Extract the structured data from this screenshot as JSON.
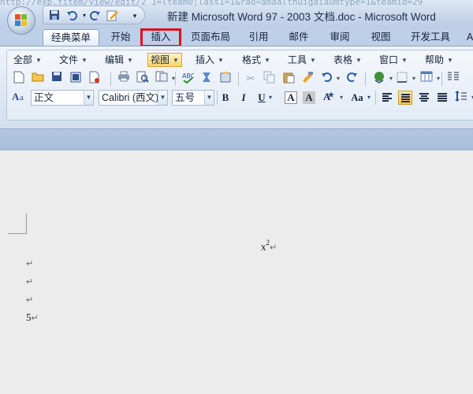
{
  "title_bar": {
    "url_ghost": "http://exp.fitem/view/edit/2 1=lteam0;lass1=1&rad=amaalthuigaiaumtype=1&teamid=29",
    "window_title": "新建 Microsoft Word 97 - 2003 文档.doc - Microsoft Word",
    "quick_access": [
      "save-icon",
      "undo-icon",
      "redo-icon",
      "customize-icon"
    ]
  },
  "tabs": [
    {
      "label": "经典菜单",
      "state": "active"
    },
    {
      "label": "开始"
    },
    {
      "label": "插入",
      "state": "highlighted"
    },
    {
      "label": "页面布局"
    },
    {
      "label": "引用"
    },
    {
      "label": "邮件"
    },
    {
      "label": "审阅"
    },
    {
      "label": "视图"
    },
    {
      "label": "开发工具"
    },
    {
      "label": "A"
    }
  ],
  "menu": [
    {
      "label": "全部"
    },
    {
      "label": "文件"
    },
    {
      "label": "编辑"
    },
    {
      "label": "视图",
      "state": "selected"
    },
    {
      "label": "插入"
    },
    {
      "label": "格式"
    },
    {
      "label": "工具"
    },
    {
      "label": "表格"
    },
    {
      "label": "窗口"
    },
    {
      "label": "帮助"
    }
  ],
  "format_bar": {
    "style": "正文",
    "font": "Calibri (西文)",
    "size": "五号",
    "bold": "B",
    "italic": "I",
    "underline": "U",
    "char_border": "A",
    "char_shading": "A",
    "change_case": "Aa"
  },
  "document": {
    "equation_base": "x",
    "equation_exp": "2",
    "para_mark": "↵",
    "lines": [
      "↵",
      "↵",
      "↵"
    ],
    "number_line": "5"
  },
  "colors": {
    "accent": "#e0101a",
    "ribbon": "#dde7f3",
    "selected_menu": "#ffd36a"
  }
}
